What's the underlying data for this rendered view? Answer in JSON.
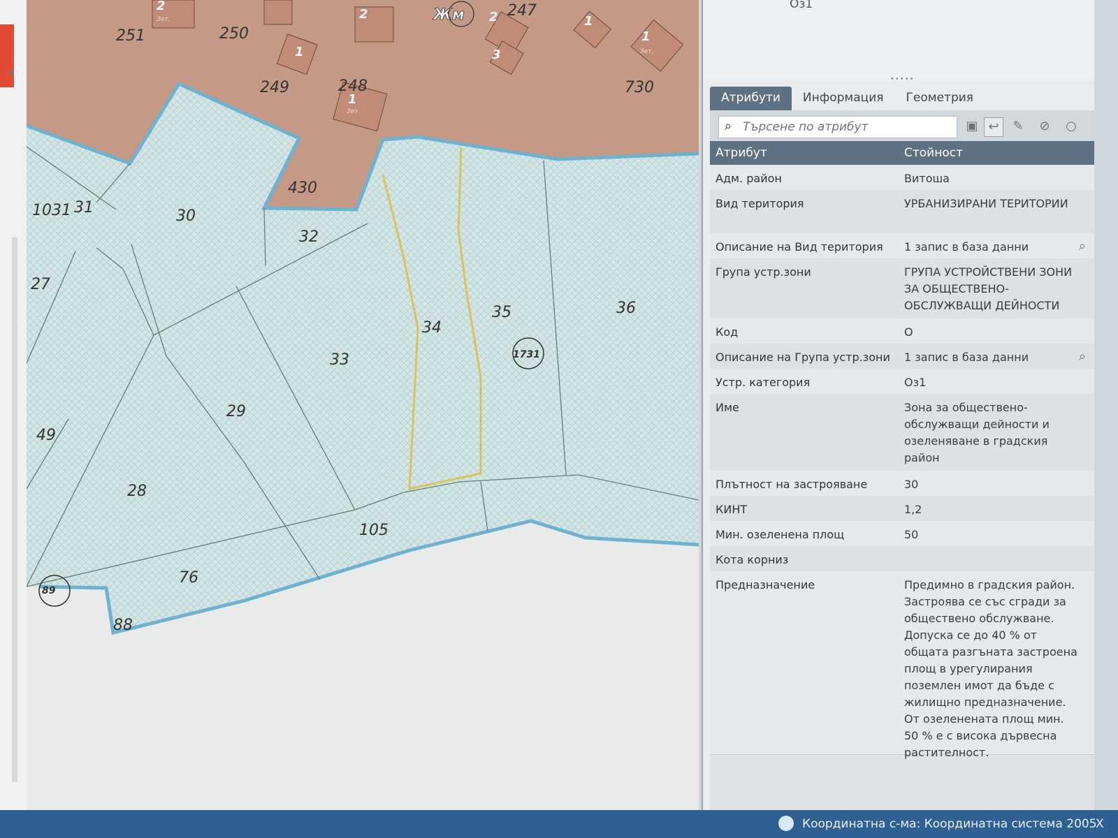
{
  "map": {
    "parcel_labels": [
      "251",
      "250",
      "249",
      "248",
      "247",
      "730",
      "430",
      "1031",
      "31",
      "30",
      "32",
      "27",
      "33",
      "34",
      "35",
      "36",
      "29",
      "49",
      "28",
      "105",
      "76",
      "88"
    ],
    "building_numbers": [
      "2",
      "2",
      "1",
      "2",
      "3",
      "1",
      "1",
      "1"
    ],
    "building_type": "Зет.",
    "zone_label": "Жм",
    "circle_labels": [
      "1731",
      "89"
    ],
    "colors": {
      "zone_fill": "#d3e6e6",
      "built_fill": "#c49a86",
      "outline": "#6fb2cf",
      "highlight": "#d7c45a"
    }
  },
  "panel": {
    "top_code": "Оз1",
    "tabs": [
      "Атрибути",
      "Информация",
      "Геометрия"
    ],
    "search_placeholder": "Търсене по атрибут",
    "toolbar_icons": [
      "save-icon",
      "undo-icon",
      "edit-icon",
      "cancel-icon",
      "circle-icon"
    ],
    "header": {
      "attr": "Атрибут",
      "value": "Стойност"
    },
    "rows": [
      {
        "key": "Адм. район",
        "value": "Витоша"
      },
      {
        "key": "Вид територия",
        "value": "УРБАНИЗИРАНИ ТЕРИТОРИИ"
      },
      {
        "key": "Описание на Вид територия",
        "value": "1 запис в база данни",
        "lookup": true
      },
      {
        "key": "Група устр.зони",
        "value": "ГРУПА УСТРОЙСТВЕНИ ЗОНИ ЗА ОБЩЕСТВЕНО-ОБСЛУЖВАЩИ ДЕЙНОСТИ"
      },
      {
        "key": "Код",
        "value": "О"
      },
      {
        "key": "Описание на Група устр.зони",
        "value": "1 запис в база данни",
        "lookup": true
      },
      {
        "key": "Устр. категория",
        "value": "Оз1"
      },
      {
        "key": "Име",
        "value": "Зона за обществено-обслужващи дейности и озеленяване в градския район"
      },
      {
        "key": "Плътност на застрояване",
        "value": "30"
      },
      {
        "key": "КИНТ",
        "value": "1,2"
      },
      {
        "key": "Мин. озеленена площ",
        "value": "50"
      },
      {
        "key": "Кота корниз",
        "value": ""
      },
      {
        "key": "Предназначение",
        "value": "Предимно в градския район. Застроява се със сгради за обществено обслужване. Допуска се до 40 % от общата разгъната застроена площ в урегулирания поземлен имот да бъде с жилищно предназначение. От озеленената площ мин. 50 % е с висока дървесна растителност."
      }
    ]
  },
  "status": {
    "text": "Координатна с-ма: Координатна система 2005",
    "close": "X"
  }
}
